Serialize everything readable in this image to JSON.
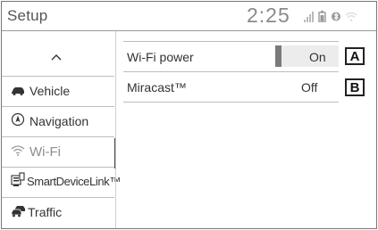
{
  "header": {
    "title": "Setup",
    "clock": "2:25",
    "status_icons": [
      "signal-icon",
      "battery-icon",
      "bluetooth-icon",
      "wifi-icon"
    ]
  },
  "sidebar": {
    "up_icon": "chevron-up-icon",
    "items": [
      {
        "label": "Vehicle",
        "icon": "car-icon",
        "active": false
      },
      {
        "label": "Navigation",
        "icon": "compass-icon",
        "active": false
      },
      {
        "label": "Wi-Fi",
        "icon": "wifi-icon",
        "active": true
      },
      {
        "label": "SmartDeviceLink™",
        "icon": "smartdevicelink-icon",
        "active": false
      },
      {
        "label": "Traffic",
        "icon": "traffic-icon",
        "active": false
      }
    ]
  },
  "main": {
    "rows": [
      {
        "label": "Wi-Fi power",
        "value": "On",
        "control": "toggle",
        "callout": "A"
      },
      {
        "label": "Miracast™",
        "value": "Off",
        "control": "text",
        "callout": "B"
      }
    ]
  }
}
